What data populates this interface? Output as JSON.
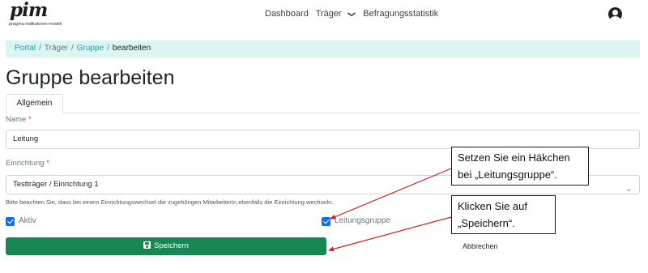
{
  "logo": {
    "word": "pim",
    "subtitle": "pragma-indikatoren-modell"
  },
  "nav": {
    "dashboard": "Dashboard",
    "traeger": "Träger",
    "traeger_caret": "❯",
    "statistik": "Befragungsstatistik",
    "user_icon": "user-circle-icon"
  },
  "breadcrumb": {
    "items": [
      "Portal",
      "Träger",
      "Gruppe",
      "bearbeiten"
    ],
    "separator": "/"
  },
  "page": {
    "title": "Gruppe bearbeiten"
  },
  "tabs": [
    {
      "label": "Allgemein",
      "active": true
    }
  ],
  "form": {
    "name_label": "Name",
    "name_required": "*",
    "name_value": "Leitung",
    "einrichtung_label": "Einrichtung",
    "einrichtung_required": "*",
    "einrichtung_value": "Testträger / Einrichtung 1",
    "hint": "Bitte beachten Sie, dass bei einem Einrichtungswechsel die zugehörigen MitarbeiterIn ebenfalls die Einrichtung wechseln.",
    "aktiv_label": "Aktiv",
    "aktiv_checked": true,
    "leitungsgruppe_label": "Leitungsgruppe",
    "leitungsgruppe_checked": true,
    "save_label": "Speichern",
    "cancel_label": "Abbrechen"
  },
  "callouts": {
    "first": [
      "Setzen Sie ein Häkchen",
      "bei „Leitungsgruppe“."
    ],
    "second": [
      "Klicken Sie auf",
      "„Speichern“."
    ]
  },
  "colors": {
    "primary": "#0d6efd",
    "success": "#198754",
    "breadcrumb_bg": "#dbf4f4",
    "link": "#17a2b8",
    "required": "#dc3545",
    "arrow": "#d62020"
  }
}
